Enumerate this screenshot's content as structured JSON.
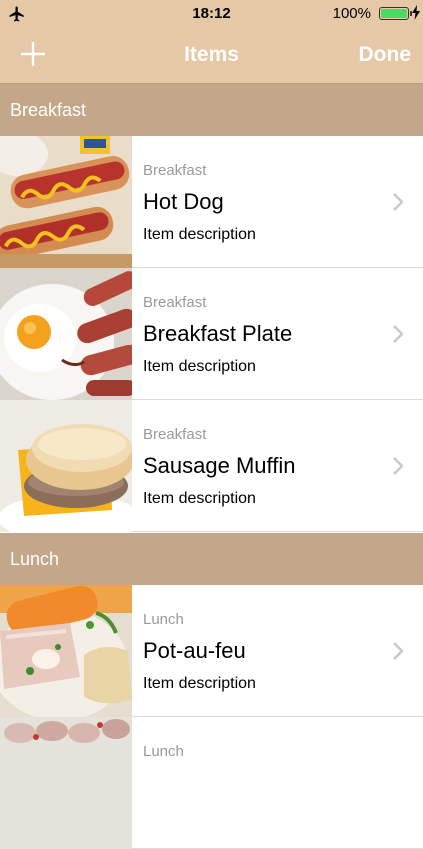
{
  "status_bar": {
    "time": "18:12",
    "battery": "100%"
  },
  "nav": {
    "title": "Items",
    "done_label": "Done"
  },
  "sections": [
    {
      "header": "Breakfast",
      "items": [
        {
          "category": "Breakfast",
          "name": "Hot Dog",
          "description": "Item description",
          "photo": "hot-dog"
        },
        {
          "category": "Breakfast",
          "name": "Breakfast Plate",
          "description": "Item description",
          "photo": "breakfast-plate"
        },
        {
          "category": "Breakfast",
          "name": "Sausage Muffin",
          "description": "Item description",
          "photo": "sausage-muffin"
        }
      ]
    },
    {
      "header": "Lunch",
      "items": [
        {
          "category": "Lunch",
          "name": "Pot-au-feu",
          "description": "Item description",
          "photo": "pot-au-feu"
        },
        {
          "category": "Lunch",
          "name": "",
          "description": "",
          "photo": "clams"
        }
      ]
    }
  ]
}
